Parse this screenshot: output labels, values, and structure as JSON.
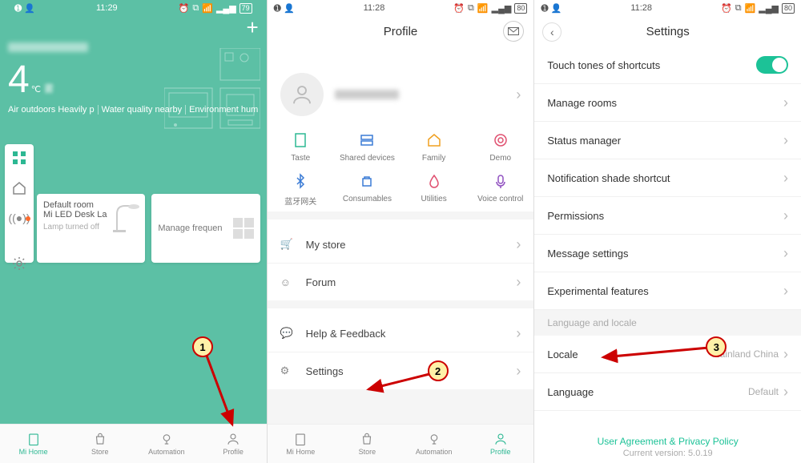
{
  "statusbar": {
    "time_s1": "11:29",
    "time_s2": "11:28",
    "time_s3": "11:28",
    "batt_s1": "79",
    "batt_s2": "80",
    "batt_s3": "80"
  },
  "screen1": {
    "temp_num": "4",
    "temp_unit": "℃",
    "temp_desc": "雾",
    "info": [
      "Air outdoors Heavily p",
      "Water quality nearby ",
      "Environment hum"
    ],
    "card1": {
      "l1": "Default room",
      "l2": "Mi LED Desk La",
      "l3": "Lamp turned off"
    },
    "card2": {
      "label": "Manage frequen"
    },
    "nav": [
      "Mi Home",
      "Store",
      "Automation",
      "Profile"
    ]
  },
  "screen2": {
    "title": "Profile",
    "icons_row1": [
      {
        "name": "Taste",
        "c": "#2db893"
      },
      {
        "name": "Shared devices",
        "c": "#3a7bd5"
      },
      {
        "name": "Family",
        "c": "#f0a020"
      },
      {
        "name": "Demo",
        "c": "#e05070"
      }
    ],
    "icons_row2": [
      {
        "name": "蓝牙网关",
        "c": "#3a7bd5"
      },
      {
        "name": "Consumables",
        "c": "#3a7bd5"
      },
      {
        "name": "Utilities",
        "c": "#e05070"
      },
      {
        "name": "Voice control",
        "c": "#9050c0"
      }
    ],
    "list": [
      "My store",
      "Forum",
      "Help & Feedback",
      "Settings"
    ],
    "nav": [
      "Mi Home",
      "Store",
      "Automation",
      "Profile"
    ]
  },
  "screen3": {
    "title": "Settings",
    "items_top": [
      "Touch tones of shortcuts",
      "Manage rooms",
      "Status manager",
      "Notification shade shortcut",
      "Permissions",
      "Message settings",
      "Experimental features"
    ],
    "section": "Language and locale",
    "locale_label": "Locale",
    "locale_value": "Mainland China",
    "language_label": "Language",
    "language_value": "Default",
    "footer1": "User Agreement & Privacy Policy",
    "footer2": "Current version: 5.0.19"
  },
  "anno": {
    "n1": "1",
    "n2": "2",
    "n3": "3"
  }
}
